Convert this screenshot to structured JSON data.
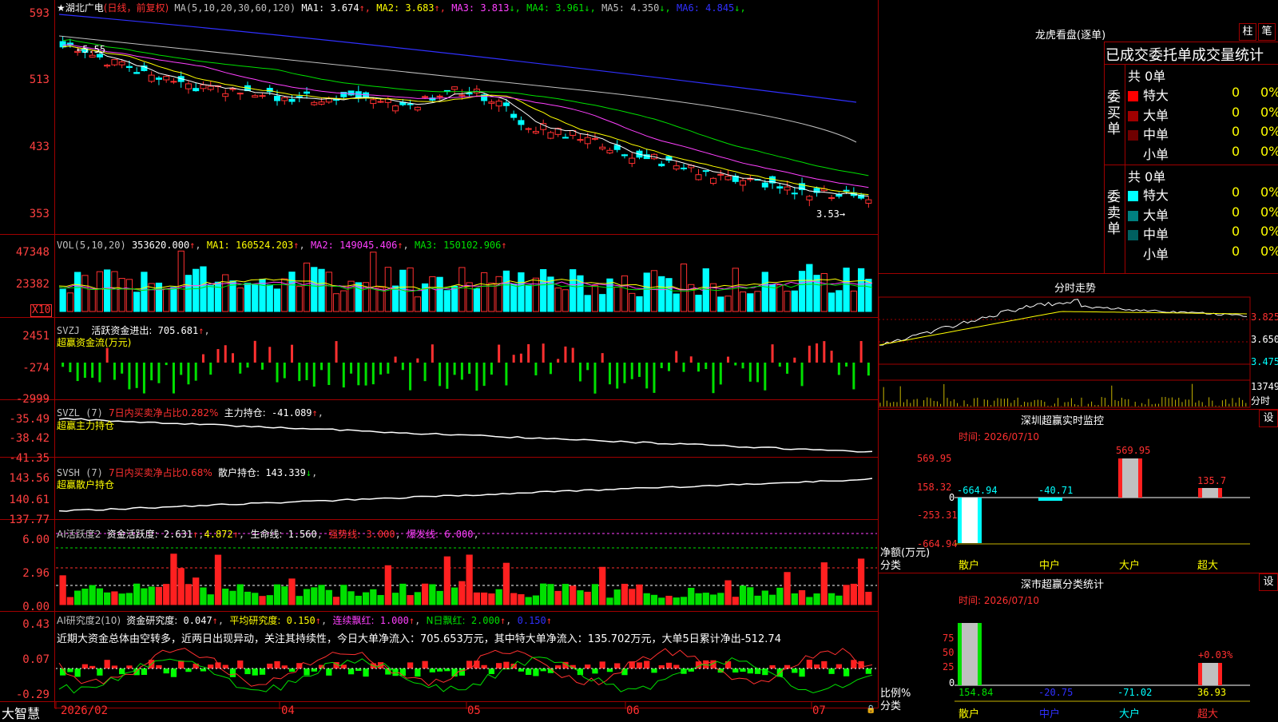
{
  "header": {
    "stock_name": "★湖北广电",
    "period": "(日线，前复权)",
    "ma_label": "MA(5,10,20,30,60,120)",
    "ma_values": [
      {
        "label": "MA1:",
        "value": "3.674",
        "arrow": "↑",
        "color": "#ffffff"
      },
      {
        "label": "MA2:",
        "value": "3.683",
        "arrow": "↑",
        "color": "#ffff00"
      },
      {
        "label": "MA3:",
        "value": "3.813",
        "arrow": "↓",
        "color": "#ff40ff"
      },
      {
        "label": "MA4:",
        "value": "3.961",
        "arrow": "↓",
        "color": "#00e000"
      },
      {
        "label": "MA5:",
        "value": "4.350",
        "arrow": "↓",
        "color": "#c0c0c0"
      },
      {
        "label": "MA6:",
        "value": "4.845",
        "arrow": "↓",
        "color": "#3030ff"
      }
    ]
  },
  "price_axis": [
    "593",
    "513",
    "433",
    "353"
  ],
  "price_annotations": {
    "high": "5.55",
    "low": "3.53"
  },
  "volume": {
    "title": "VOL(5,10,20)",
    "value": "353620.000",
    "ma1": "160524.203",
    "ma2": "149045.406",
    "ma3": "150102.906",
    "axis": [
      "47348",
      "23382"
    ],
    "unit": "X10"
  },
  "svzj": {
    "title": "SVZJ",
    "label": "活跃资金进出:",
    "value": "705.681",
    "subtitle": "超赢资金流(万元)",
    "axis": [
      "2451",
      "-274",
      "-2999"
    ]
  },
  "svzl": {
    "title": "SVZL (7)",
    "ratio_label": "7日内买卖净占比0.282%",
    "label": "主力持仓:",
    "value": "-41.089",
    "subtitle": "超赢主力持仓",
    "axis": [
      "-35.49",
      "-38.42",
      "-41.35"
    ]
  },
  "svsh": {
    "title": "SVSH (7)",
    "ratio_label": "7日内买卖净占比0.68%",
    "label": "散户持仓:",
    "value": "143.339",
    "subtitle": "超赢散户持仓",
    "axis": [
      "143.56",
      "140.61",
      "137.77"
    ]
  },
  "ai_active": {
    "title": "AI活跃度2",
    "label": "资金活跃度:",
    "value1": "2.631",
    "value2": "4.872",
    "life_label": "生命线:",
    "life_value": "1.560",
    "strong_label": "强势线:",
    "strong_value": "3.000",
    "burst_label": "爆发线:",
    "burst_value": "6.000",
    "axis": [
      "6.00",
      "2.96",
      "0.00"
    ]
  },
  "ai_research": {
    "title": "AI研究度2(10)",
    "label": "资金研究度:",
    "value": "0.047",
    "avg_label": "平均研究度:",
    "avg_value": "0.150",
    "red_label": "连续飘红:",
    "red_value": "1.000",
    "nred_label": "N日飘红:",
    "nred_value": "2.000",
    "extra": "0.150",
    "comment": "近期大资金总体由空转多，近两日出现异动，关注其持续性，今日大单净流入：705.653万元，其中特大单净流入：135.702万元，大单5日累计净出-512.74",
    "axis": [
      "0.43",
      "0.07",
      "-0.29"
    ]
  },
  "date_axis": [
    "2026/02",
    "04",
    "05",
    "06",
    "07"
  ],
  "bottom_left": "大智慧",
  "right_panel": {
    "dragon_title": "龙虎看盘(逐单)",
    "btn_bar": "柱",
    "btn_pen": "笔",
    "tabs": "已成交委托单成交量统计",
    "buy_label": "委买单",
    "sell_label": "委卖单",
    "buy_total": "共 0单",
    "sell_total": "共 0单",
    "buy_rows": [
      {
        "name": "特大",
        "count": "0",
        "pct": "0%",
        "color": "#ff0000"
      },
      {
        "name": "大单",
        "count": "0",
        "pct": "0%",
        "color": "#a00000"
      },
      {
        "name": "中单",
        "count": "0",
        "pct": "0%",
        "color": "#700000"
      },
      {
        "name": "小单",
        "count": "0",
        "pct": "0%",
        "color": "#000000"
      }
    ],
    "sell_rows": [
      {
        "name": "特大",
        "count": "0",
        "pct": "0%",
        "color": "#00ffff"
      },
      {
        "name": "大单",
        "count": "0",
        "pct": "0%",
        "color": "#008080"
      },
      {
        "name": "中单",
        "count": "0",
        "pct": "0%",
        "color": "#006060"
      },
      {
        "name": "小单",
        "count": "0",
        "pct": "0%",
        "color": "#000000"
      }
    ],
    "intraday_title": "分时走势",
    "intraday_axis": [
      "3.825",
      "3.650",
      "3.475"
    ],
    "intraday_vol": "13749",
    "intraday_vol_label": "分时",
    "monitor_title": "深圳超赢实时监控",
    "monitor_btn": "设",
    "monitor_time": "时间: 2026/07/10",
    "monitor_axis": [
      "569.95",
      "158.32",
      "0",
      "-253.31",
      "-664.94"
    ],
    "monitor_values": [
      "-664.94",
      "-40.71",
      "569.95",
      "135.7"
    ],
    "monitor_ylabel": "净额(万元)",
    "monitor_xlabel": "分类",
    "categories": [
      "散户",
      "中户",
      "大户",
      "超大"
    ],
    "stats_title": "深市超赢分类统计",
    "stats_btn": "设",
    "stats_time": "时间: 2026/07/10",
    "stats_axis": [
      "75",
      "50",
      "25",
      "0"
    ],
    "stats_pct_label": "+0.03%",
    "stats_values": [
      "154.84",
      "-20.75",
      "-71.02",
      "36.93"
    ],
    "stats_ylabel": "比例%",
    "stats_xlabel": "分类"
  }
}
